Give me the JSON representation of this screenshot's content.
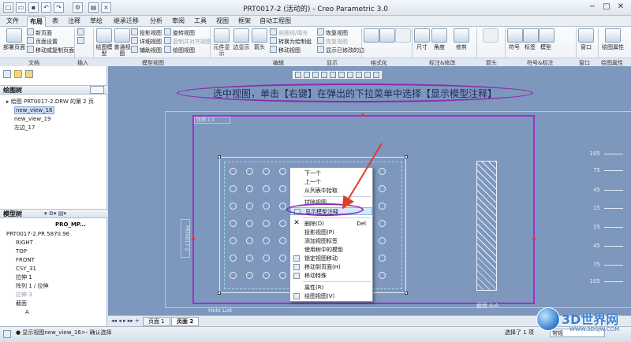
{
  "window": {
    "title": "PRT0017-2 (活动的) - Creo Parametric 3.0",
    "min_label": "−",
    "max_label": "□",
    "close_label": "✕"
  },
  "tabs": [
    "文件",
    "布局",
    "表",
    "注释",
    "草绘",
    "继承迁移",
    "分析",
    "审阅",
    "工具",
    "视图",
    "框架",
    "自动工程图"
  ],
  "ribbon": {
    "doc": {
      "new_page": "新页面",
      "page_setup": "页面设置",
      "move_copy": "移动或复制页面",
      "deploy": "部署页面",
      "group": "文档"
    },
    "insert": {
      "group": "插入"
    },
    "model_views": {
      "general": "绘图模型",
      "general2": "普通视图",
      "projection": "投影视图",
      "detail": "详细视图",
      "auxiliary": "辅助视图",
      "rotate": "旋转视图",
      "copy_align": "复制并对齐视图",
      "draw_view": "绘图视图",
      "group": "模型视图"
    },
    "edit": {
      "element_view": "元件显示",
      "sep_view": "边显示",
      "line_fill": "箭头",
      "convert": "转换为绘制组",
      "move_view": "移动视图",
      "hatch": "剖面线/填充",
      "restore": "恢复视图",
      "show_modified": "显示已修改的边",
      "arrow": "箭头",
      "group": "编辑"
    },
    "display": {
      "group": "显示"
    },
    "format": {
      "group": "格式化"
    },
    "annotate": {
      "size": "尺寸",
      "angle": "角度",
      "trim": "修剪",
      "group": "标注&修改"
    },
    "arrow": {
      "group": "箭头"
    },
    "symbol": {
      "symbol": "符号",
      "label": "标签",
      "model": "模型",
      "group": "符号&标注"
    },
    "window": {
      "window": "窗口",
      "group": "窗口"
    },
    "draw_props": {
      "props": "绘图属性",
      "group": "绘图属性"
    }
  },
  "left": {
    "drawing_tree_title": "绘图树",
    "drawing_tree": [
      {
        "label": "绘图 PRT0017-2.DRW 的第 2 页",
        "selected": false
      },
      {
        "label": "new_view_16",
        "selected": true
      },
      {
        "label": "new_view_19",
        "selected": false
      },
      {
        "label": "左边_17",
        "selected": false
      }
    ],
    "model_tree_title": "模型树",
    "model_tree_header": "PRO_MP...",
    "model_tree": [
      {
        "label": "PRT0017-2.PR 5870.96",
        "dim": false
      },
      {
        "label": "RIGHT",
        "dim": false
      },
      {
        "label": "TOP",
        "dim": false
      },
      {
        "label": "FRONT",
        "dim": false
      },
      {
        "label": "CSY_31",
        "dim": false
      },
      {
        "label": "拉伸 1",
        "dim": false
      },
      {
        "label": "阵列 1 / 拉伸",
        "dim": false
      },
      {
        "label": "拉伸 3",
        "dim": true
      },
      {
        "label": "截面",
        "dim": false
      },
      {
        "label": "A",
        "dim": false
      }
    ]
  },
  "canvas": {
    "callout": "选中视图，单击【右键】在弹出的下拉菜单中选择【显示模型注释】",
    "view_label": "比例 1:1",
    "section_label": "截面 A-A",
    "section_label2": "截面 A-A",
    "hole_list": "Hole List",
    "right_dims": [
      "105",
      "75",
      "45",
      "15",
      "15",
      "45",
      "75",
      "105"
    ],
    "side_note": "PRT0017-2"
  },
  "context_menu": {
    "items": [
      {
        "label": "下一个",
        "shortcut": ""
      },
      {
        "label": "上一个",
        "shortcut": ""
      },
      {
        "label": "从列表中拾取",
        "shortcut": ""
      },
      {
        "label": "拭除视图",
        "shortcut": ""
      },
      {
        "label": "显示模型注释",
        "shortcut": ""
      },
      {
        "label": "删除(D)",
        "shortcut": "Del"
      },
      {
        "label": "投影视图(P)",
        "shortcut": ""
      },
      {
        "label": "添加视图标签",
        "shortcut": ""
      },
      {
        "label": "使用树中的模型",
        "shortcut": ""
      },
      {
        "label": "锁定视图移动",
        "shortcut": ""
      },
      {
        "label": "移动到页面(H)",
        "shortcut": ""
      },
      {
        "label": "移动特殊",
        "shortcut": ""
      },
      {
        "label": "属性(R)",
        "shortcut": ""
      },
      {
        "label": "绘图视图(V)",
        "shortcut": ""
      }
    ]
  },
  "sheet_tabs": [
    "页面 1",
    "页面 2"
  ],
  "status": {
    "message": "● 显示视图new_view_16>- 确认选择",
    "filter_label": "选择了 1 项",
    "filter_value": "常规"
  },
  "watermark": {
    "text": "3D世界网",
    "url": "WWW.3DSJW.COM"
  },
  "colors": {
    "accent": "#8a2bb0",
    "canvas": "#7e97bd",
    "highlight": "#d6e7fb",
    "arrow": "#e23b2c"
  }
}
